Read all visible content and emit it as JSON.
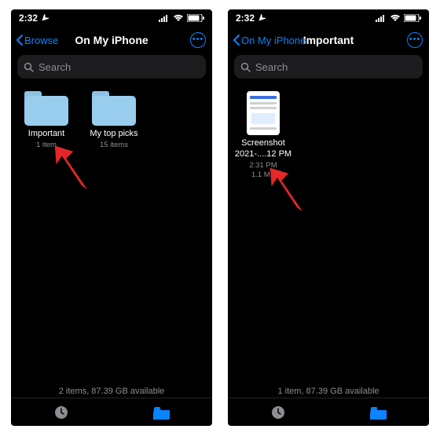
{
  "left": {
    "status": {
      "time": "2:32",
      "loc_arrow": "➤"
    },
    "nav": {
      "back": "Browse",
      "title": "On My iPhone"
    },
    "search": {
      "placeholder": "Search"
    },
    "items": [
      {
        "name": "Important",
        "meta": "1 item"
      },
      {
        "name": "My top picks",
        "meta": "15 items"
      }
    ],
    "footer": "2 items, 87.39 GB available"
  },
  "right": {
    "status": {
      "time": "2:32",
      "loc_arrow": "➤"
    },
    "nav": {
      "back": "On My iPhone",
      "title": "Important"
    },
    "search": {
      "placeholder": "Search"
    },
    "items": [
      {
        "name_l1": "Screenshot",
        "name_l2": "2021-....12 PM",
        "meta1": "2:31 PM",
        "meta2": "1.1 MB"
      }
    ],
    "footer": "1 item, 87.39 GB available"
  },
  "colors": {
    "accent": "#0a84ff",
    "folder": "#98cdee"
  }
}
